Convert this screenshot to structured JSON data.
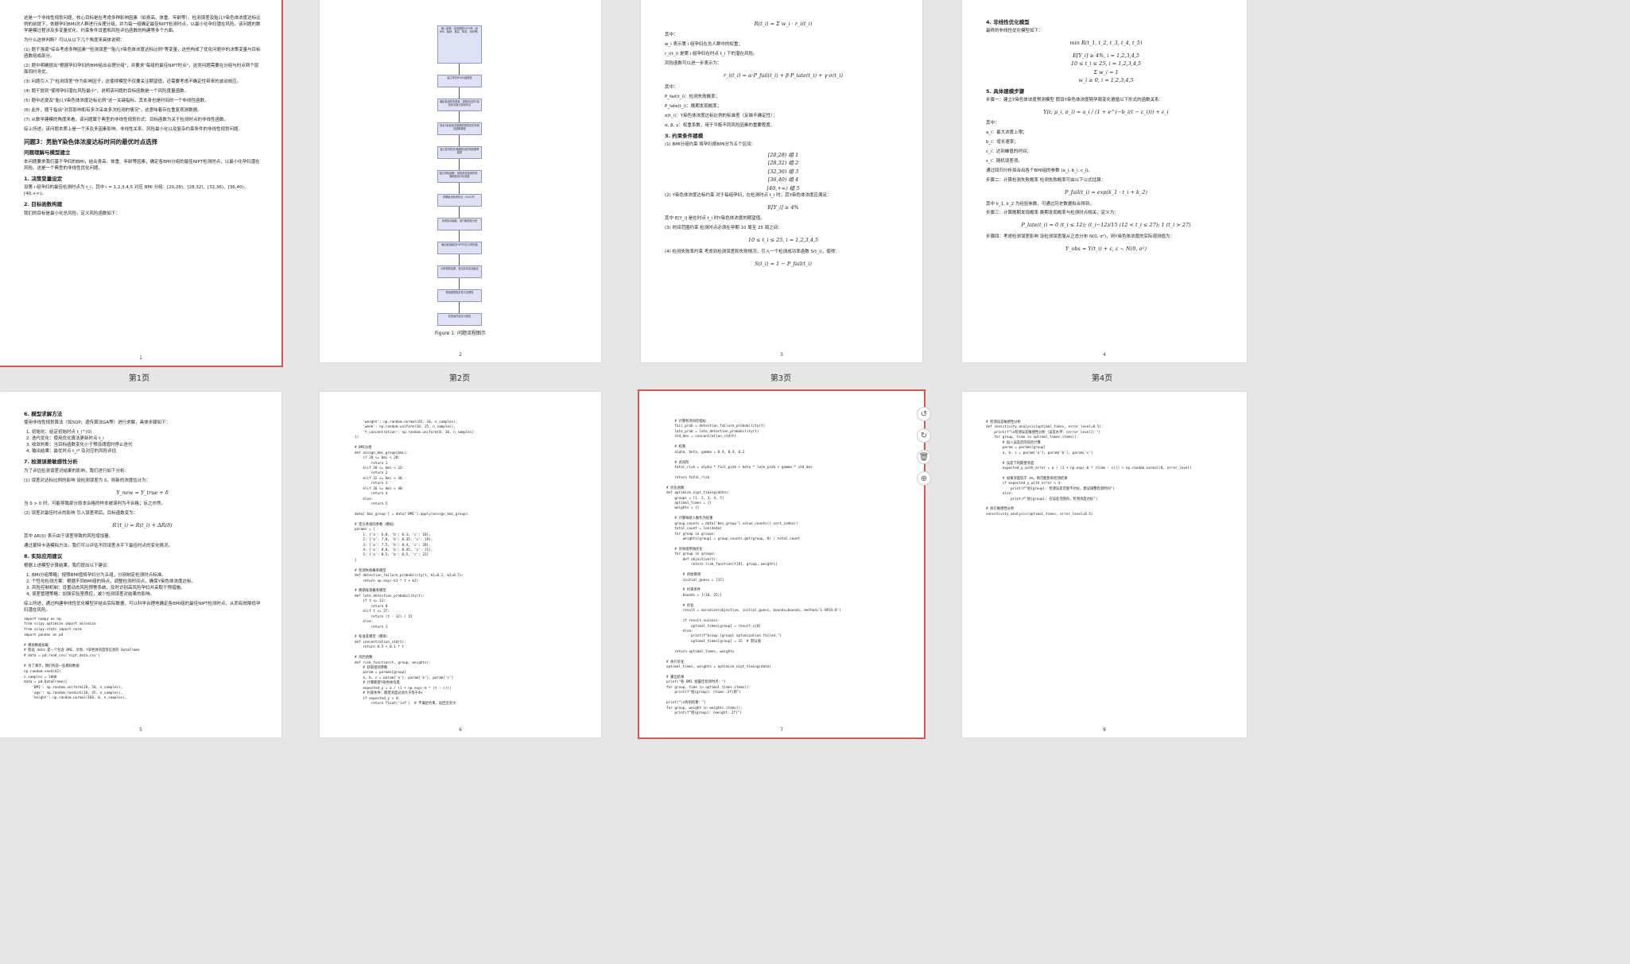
{
  "pages": [
    {
      "number": "1",
      "label": "第1页"
    },
    {
      "number": "2",
      "label": "第2页"
    },
    {
      "number": "3",
      "label": "第3页"
    },
    {
      "number": "4",
      "label": "第4页"
    },
    {
      "number": "5",
      "label": ""
    },
    {
      "number": "6",
      "label": ""
    },
    {
      "number": "7",
      "label": ""
    },
    {
      "number": "8",
      "label": ""
    }
  ],
  "p1": {
    "intro": "这是一个非线性规划问题，核心目标是在考虑多种影响因素（如身高、体重、年龄等）、检测误差及胎儿Y染色体浓度达标比例的前提下，依据孕妇BMI对人群进行合理分组，并为每一组确定最佳NIPT检测时点，以最小化孕妇潜在风险。该问题的数学建模过程涉及多变量优化、约束条件设置和风险评估函数的构建等多个方面。",
    "reason": "为什么这样判断？可以从以下几个角度来具体说明：",
    "items": [
      "(1) 题干强调\"综合考虑多种因素\"\"检测误差\"\"胎儿Y染色体浓度达标比例\"等变量，这些构成了优化问题中的决策变量与目标函数组成部分。",
      "(2) 题中明确提出\"根据孕妇孕妇的BMI给出合理分组\"，并要求\"每组的最佳NIPT时点\"，这类问题需要在分组与时点两个层面同时寻优。",
      "(3) 问题引入了\"检测误差\"作为影响因子，这使得模型不仅要关注期望值，还需要考虑不确定性带来的波动效应。",
      "(4) 题干提到\"使得孕妇潜在风险最小\"，说明该问题的目标函数是一个风险度量函数。",
      "(5) 题中还提及\"胎儿Y染色体浓度达标比例\"这一关键指标，其本身也是时间的一个非线性函数。",
      "(6) 此外，题干指出\"对其影响和有多次采血多次检测的情况\"，这意味着存在重复观测数据。",
      "(7) 从数学建模的角度来看，该问题属于典型的非线性规划形式：目标函数为关于检测时点的非线性函数。"
    ],
    "summary": "综上所述，该问题本质上是一个涉及多因素影响、非线性关系、风险最小化以及复杂约束条件的非线性规划问题。",
    "problem_title": "问题3：男胎Y染色体浓度达标时间的最优时点选择",
    "section_title": "问题理解与模型建立",
    "section_text": "本问题要求我们基于孕妇的BMI，结合身高、体重、年龄等因素，确定各BMI分组的最佳NIPT检测时点，以最小化孕妇潜在风险。这是一个典型的非线性优化问题。",
    "sub1": "1. 决策变量设定",
    "sub1_text": "设第 i 组孕妇的最佳检测时点为 t_i，其中 i = 1,2,3,4,5 对应 BMI 分组：[20,28)、[28,32)、[32,36)、[36,40)、[40,+∞)。",
    "sub2": "2. 目标函数构建",
    "sub2_text": "我们的目标是最小化总风险，定义风险函数如下："
  },
  "p2": {
    "flow": [
      "输入参数：检测数据2025年（含BMI、胎龄、身高、体重、年龄等）",
      "建立孕妇BMI分组模型",
      "确定各组样本数量，提取对应的Y染色体浓度与检测时点",
      "拟合Y染色体浓度随孕周变化的非线性函数模型",
      "建立检测失败/晚期检测的风险概率模型",
      "建立风险函数：加权综合检测失败、晚期检测与标准差",
      "求解最优检测时点（SLSQP）",
      "考虑检测误差，进行敏感性分析",
      "输出各组最佳NIPT时点与风险值",
      "分析模型结果，提出实际应用建议",
      "检验模型稳定性与合理性",
      "形成最终结论与报告"
    ],
    "caption": "Figure 1: 问题流程图示"
  },
  "p3": {
    "eq1": "R(t_i) = Σ w_i · r_i(t_i)",
    "lines": [
      "其中：",
      "w_i 表示第 i 组孕妇在总人群中的权重；",
      "r_i(t_i) 是第 i 组孕妇在时点 t_i 下的潜在风险。",
      "风险函数可以进一步表示为："
    ],
    "eq2": "r_i(t_i) = α·P_fail(t_i) + β·P_late(t_i) + γ·σ(t_i)",
    "lines2": [
      "其中：",
      "P_fail(t_i)：检测失败概率；",
      "P_late(t_i)：晚期发现概率；",
      "σ(t_i)：Y染色体浓度达标比例的标准差（反映不确定性）；",
      "α, β, γ：权重系数，用于平衡不同风险因素的重要程度。"
    ],
    "h_constraints": "3. 约束条件建模",
    "c1": "(1) BMI分组约束  将孕妇按BMI分为五个区间：",
    "groups": [
      "[20,28)   组 1",
      "[28,32)   组 2",
      "[32,36)   组 3",
      "[36,40)   组 4",
      "[40,+∞)   组 5"
    ],
    "c2": "(2) Y染色体浓度达标约束  对于每组孕妇，在检测时点 t_i 时，其Y染色体浓度应满足：",
    "eq3": "E[Y_i] ≥ 4%",
    "c2b": "其中 E[Y_i] 是在时点 t_i 时Y染色体浓度的期望值。",
    "c3": "(3) 时间范围约束  检测时点必须在孕期 10 周至 25 周之间：",
    "eq4": "10 ≤ t_i ≤ 25,   i = 1,2,3,4,5",
    "c4": "(4) 检测失败率约束  考虑到检测误差和失败情况，引入一个检测成功率函数 S(t_i)，使得：",
    "eq5": "S(t_i) = 1 − P_fail(t_i)"
  },
  "p4": {
    "h4": "4. 非线性优化模型",
    "t4": "最终的非线性优化模型如下：",
    "eq_min": "min R(t_1, t_2, t_3, t_4, t_5)",
    "st": [
      "E[Y_i] ≥ 4%,   i = 1,2,3,4,5",
      "10 ≤ t_i ≤ 25,   i = 1,2,3,4,5",
      "Σ w_i = 1",
      "w_i ≥ 0,   i = 1,2,3,4,5"
    ],
    "h5": "5. 具体建模步骤",
    "s1": "步骤一：建立Y染色体浓度预测模型  假设Y染色体浓度随孕周变化遵循以下形式的函数关系：",
    "eq_y": "Y(t; μ_i, σ_i) = a_i / (1 + e^(−b_i(t − c_i))) + ε_i",
    "s1_lines": [
      "其中：",
      "a_i：最大浓度上限；",
      "b_i：增长速率；",
      "c_i：达到峰值的时间；",
      "ε_i：随机误差项。",
      "通过回归分析拟合出各个BMI组的参数 (a_i, b_i, c_i)。"
    ],
    "s2": "步骤二：计算检测失败概率  检测失败概率可由以下公式估算：",
    "eq_fail": "P_fail(t_i) = exp(k_1 · t_i + k_2)",
    "s2b": "其中 k_1, k_2 为经验参数，可通过历史数据拟合得到。",
    "s3": "步骤三：计算晚期发现概率  晚期发现概率与检测时点相关，定义为：",
    "eq_late": "P_late(t_i) = 0 (t_i ≤ 12); (t_i−12)/15 (12 < t_i ≤ 27); 1 (t_i > 27)",
    "s4": "步骤四：考虑检测误差影响  设检测误差服从正态分布 N(0, σ²)，则Y染色体浓度的实际观测值为：",
    "eq_obs": "Y_obs = Y(t_i) + ε,   ε ~ N(0, σ²)"
  },
  "p5": {
    "h6": "6. 模型求解方法",
    "t6": "使用非线性规划算法（如SQP、遗传算法GA等）进行求解，具体步骤如下：",
    "steps": [
      "初始化：给定初始时点 t_i^(0)",
      "迭代优化：使用优化算法更新时点 t_i",
      "收敛判断：当目标函数变化小于预设阈值时停止迭代",
      "输出结果：最优时点 t_i* 及对应的风险评估"
    ],
    "h7": "7. 检测误差敏感性分析",
    "t7": "为了评估检测误差对结果的影响，我们进行如下分析：",
    "e1": "(1) 误差对达标比例的影响  设检测误差为 δ，则新的浓度估计为：",
    "eq_e1": "Y_new = Y_true + δ",
    "e1b": "当 δ > 0 时，可能导致部分原本合格的样本被误判为不合格；反之亦然。",
    "e2": "(2) 误差对最佳时点的影响  引入误差项后，目标函数变为：",
    "eq_e2": "R'(t_i) = R(t_i) + ΔR(δ)",
    "e2b": "其中 ΔR(δ) 表示由于误差导致的风险增加量。",
    "e2c": "通过蒙特卡洛模拟方法，我们可以评估不同误差水平下最佳时点的变化情况。",
    "h8": "8. 实际应用建议",
    "t8": "根据上述模型计算结果，我们提出以下建议：",
    "advice": [
      "BMI分组策略：按照BMI值将孕妇分为五组，分别制定检测时点标准。",
      "个性化检测方案：根据不同BMI组的特点，调整检测时间点，确保Y染色体浓度达标。",
      "风险控制机制：设置动态风险预警系统，及时识别高风险孕妇并采取干预措施。",
      "误差管理策略：加强实验室质控，减少检测误差对结果的影响。"
    ],
    "t8b": "综上所述，通过构建非线性优化模型并结合实际数据，可以科学合理地确定各BMI组的最佳NIPT检测时点，从而有效降低孕妇潜在风险。"
  },
  "code5": "import numpy as np\nfrom scipy.optimize import minimize\nfrom scipy.stats import norm\nimport pandas as pd\n\n# 模拟数据加载\n# 假设 data 是一个包含 BMI、孕周、Y染色体浓度等信息的 DataFrame\n# data = pd.read_csv('nipt_data.csv')\n\n# 为了演示，我们构造一些模拟数据\nnp.random.seed(42)\nn_samples = 1000\ndata = pd.DataFrame({\n    'BMI': np.random.uniform(20, 50, n_samples),\n    'age': np.random.randint(20, 45, n_samples),\n    'height': np.random.normal(160, 8, n_samples),",
  "code6": "    'weight': np.random.normal(65, 10, n_samples),\n    'week': np.random.uniform(10, 25, n_samples),\n    'Y_concentration': np.random.uniform(0, 10, n_samples)\n})\n\n# BMI分组\ndef assign_bmi_group(bmi):\n    if 20 <= bmi < 28:\n        return 1\n    elif 28 <= bmi < 32:\n        return 2\n    elif 32 <= bmi < 36:\n        return 3\n    elif 36 <= bmi < 40:\n        return 4\n    else:\n        return 5\n\ndata['bmi_group'] = data['BMI'].apply(assign_bmi_group)\n\n# 定义各组的参数（模拟）\nparams = {\n    1: {'a': 6.0, 'b': 0.3, 'c': 18},\n    2: {'a': 7.0, 'b': 0.35, 'c': 19},\n    3: {'a': 7.5, 'b': 0.4, 'c': 20},\n    4: {'a': 8.0, 'b': 0.45, 'c': 21},\n    5: {'a': 8.5, 'b': 0.5, 'c': 22}\n}\n\n# 检测失败概率模型\ndef detection_failure_probability(t, k1=0.1, k2=0.5):\n    return np.exp(-k1 * t + k2)\n\n# 晚期发现概率模型\ndef late_detection_probability(t):\n    if t <= 12:\n        return 0\n    elif t <= 27:\n        return (t - 12) / 15\n    else:\n        return 1\n\n# 标准差模型（模拟）\ndef concentration_std(t):\n    return 0.5 + 0.1 * t\n\n# 风险函数\ndef risk_function(t, group, weights):\n    # 获取组别参数\n    param = params[group]\n    a, b, c = param['a'], param['b'], param['c']\n    # 计算期望Y染色体浓度\n    expected_y = a / (1 + np.exp(-b * (t - c)))\n    # 约束条件：期望浓度必须大于等于4%\n    if expected_y < 4:\n        return float('inf')  # 不满足约束，返回无穷大",
  "code7": "    # 计算各项风险指标\n    fail_prob = detection_failure_probability(t)\n    late_prob = late_detection_probability(t)\n    std_dev = concentration_std(t)\n\n    # 权重\n    alpha, beta, gamma = 0.4, 0.4, 0.2\n\n    # 总风险\n    total_risk = alpha * fail_prob + beta * late_prob + gamma * std_dev\n\n    return total_risk\n\n# 优化函数\ndef optimize_nipt_timing(data):\n    groups = [1, 2, 3, 4, 5]\n    optimal_times = {}\n    weights = {}\n\n    # 计算每组人数作为权重\n    group_counts = data['bmi_group'].value_counts().sort_index()\n    total_count = len(data)\n    for group in groups:\n        weights[group] = group_counts.get(group, 0) / total_count\n\n    # 对每组单独优化\n    for group in groups:\n        def objective(t):\n            return risk_function(t[0], group, weights)\n\n        # 初始猜测\n        initial_guess = [15]\n\n        # 约束条件\n        bounds = [(10, 25)]\n\n        # 优化\n        result = minimize(objective, initial_guess, bounds=bounds, method='L-BFGS-B')\n\n        if result.success:\n            optimal_times[group] = result.x[0]\n        else:\n            print(f\"Group {group} optimization failed.\")\n            optimal_times[group] = 15  # 默认值\n\n    return optimal_times, weights\n\n# 执行优化\noptimal_times, weights = optimize_nipt_timing(data)\n\n# 输出结果\nprint(\"各 BMI 组最佳检测时点：\")\nfor group, time in optimal_times.items():\n    print(f\"组{group}: {time:.2f}周\")\n\nprint(\"\\n各组权重：\")\nfor group, weight in weights.items():\n    print(f\"组{group}: {weight:.2f}\")",
  "code8": "# 检测误差敏感性分析\ndef sensitivity_analysis(optimal_times, error_level=0.5):\n    print(f\"\\n检测误差敏感性分析（误差水平：{error_level}）\")\n    for group, time in optimal_times.items():\n        # 加入误差后的风险计算\n        param = params[group]\n        a, b, c = param['a'], param['b'], param['c']\n\n        # 误差下的期望浓度\n        expected_y_with_error = a / (1 + np.exp(-b * (time - c))) + np.random.normal(0, error_level)\n\n        # 如果浓度低于 4%，则可能影响检测结果\n        if expected_y_with_error < 4:\n            print(f\"组{group}: 检测误差可能不达标，建议调整检测时间\")\n        else:\n            print(f\"组{group}: 在误差范围内，检测浓度达标\")\n\n# 执行敏感性分析\nsensitivity_analysis(optimal_times, error_level=0.5)",
  "toolbar": [
    {
      "name": "rotate-left-icon",
      "glyph": "↺"
    },
    {
      "name": "rotate-right-icon",
      "glyph": "↻"
    },
    {
      "name": "delete-icon",
      "glyph": "🗑"
    },
    {
      "name": "add-page-icon",
      "glyph": "⊕"
    }
  ],
  "colors": {
    "selected_outline": "#d9534f",
    "background": "#e6e6e6"
  }
}
